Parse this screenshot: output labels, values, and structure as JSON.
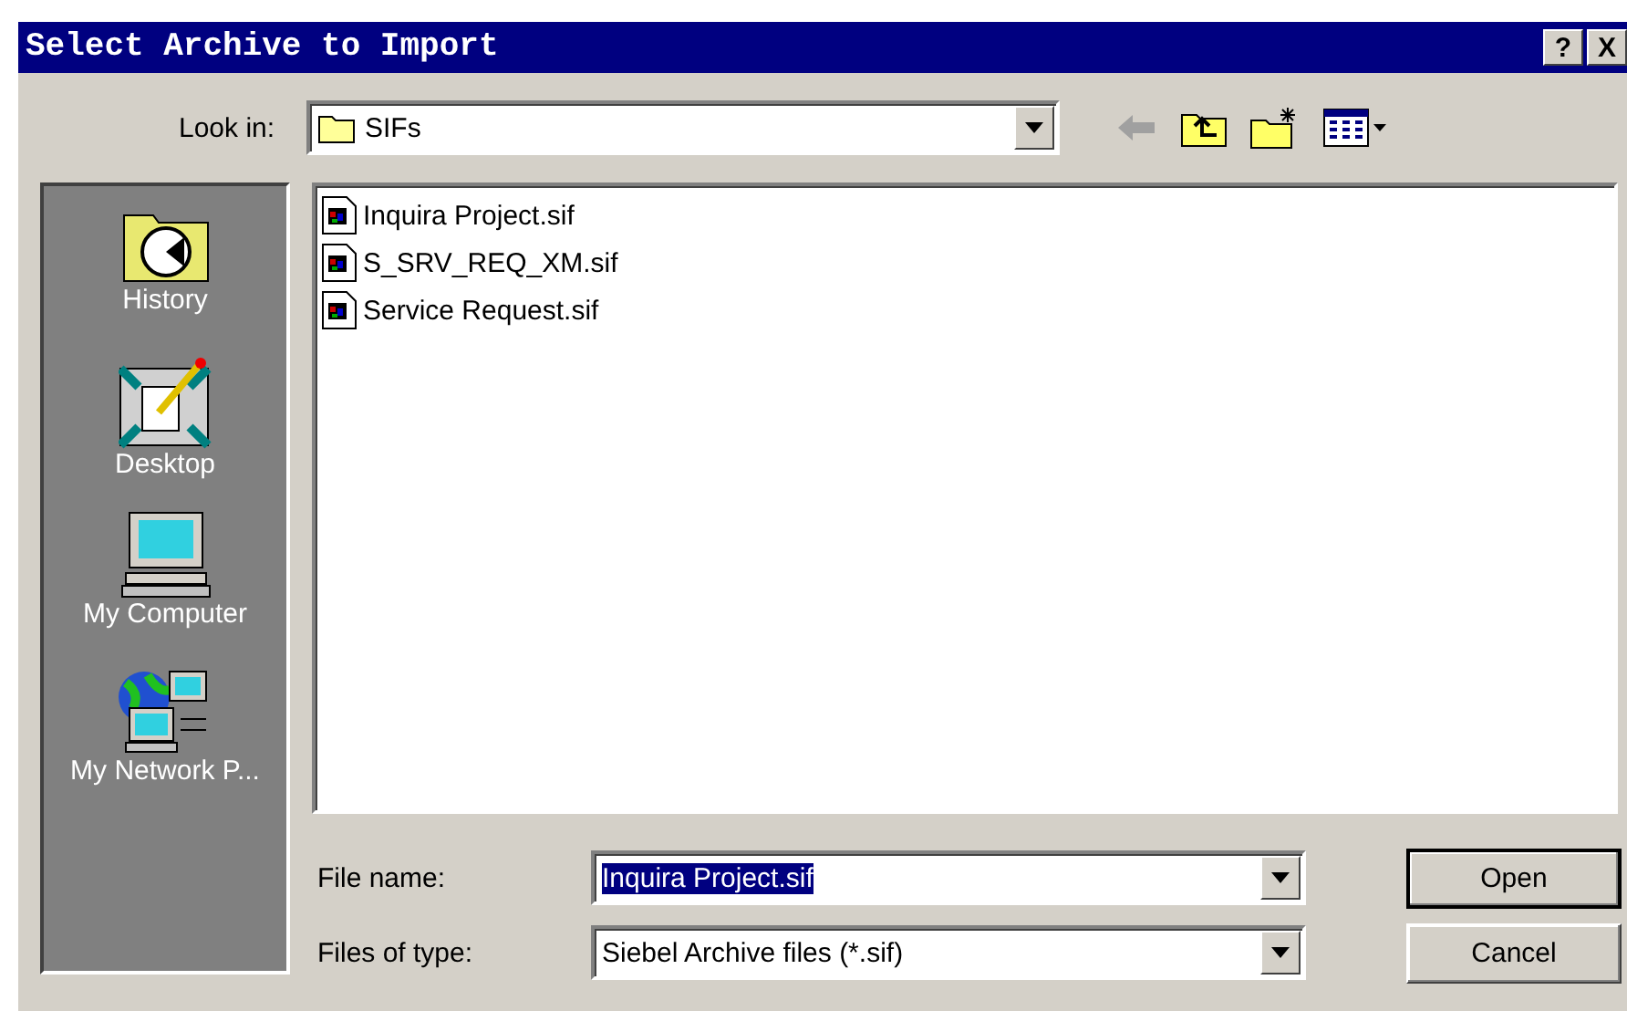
{
  "window": {
    "title": "Select Archive to Import",
    "buttons": [
      "?",
      "X"
    ]
  },
  "look_in": {
    "label": "Look in:",
    "value": "SIFs"
  },
  "toolbar": [
    {
      "kind": "back",
      "disabled": true
    },
    {
      "kind": "up",
      "disabled": false
    },
    {
      "kind": "new-folder",
      "disabled": false
    },
    {
      "kind": "views",
      "disabled": false
    }
  ],
  "places": [
    {
      "kind": "history",
      "label": "History"
    },
    {
      "kind": "desktop",
      "label": "Desktop"
    },
    {
      "kind": "computer",
      "label": "My Computer"
    },
    {
      "kind": "network",
      "label": "My Network P..."
    }
  ],
  "files": [
    {
      "name": "Inquira Project.sif"
    },
    {
      "name": "S_SRV_REQ_XM.sif"
    },
    {
      "name": "Service Request.sif"
    }
  ],
  "file_name": {
    "label": "File name:",
    "value": "Inquira Project.sif",
    "text_selected": true
  },
  "file_type": {
    "label": "Files of type:",
    "value": "Siebel Archive files (*.sif)"
  },
  "actions": [
    {
      "label": "Open",
      "default": true
    },
    {
      "label": "Cancel",
      "default": false
    }
  ]
}
